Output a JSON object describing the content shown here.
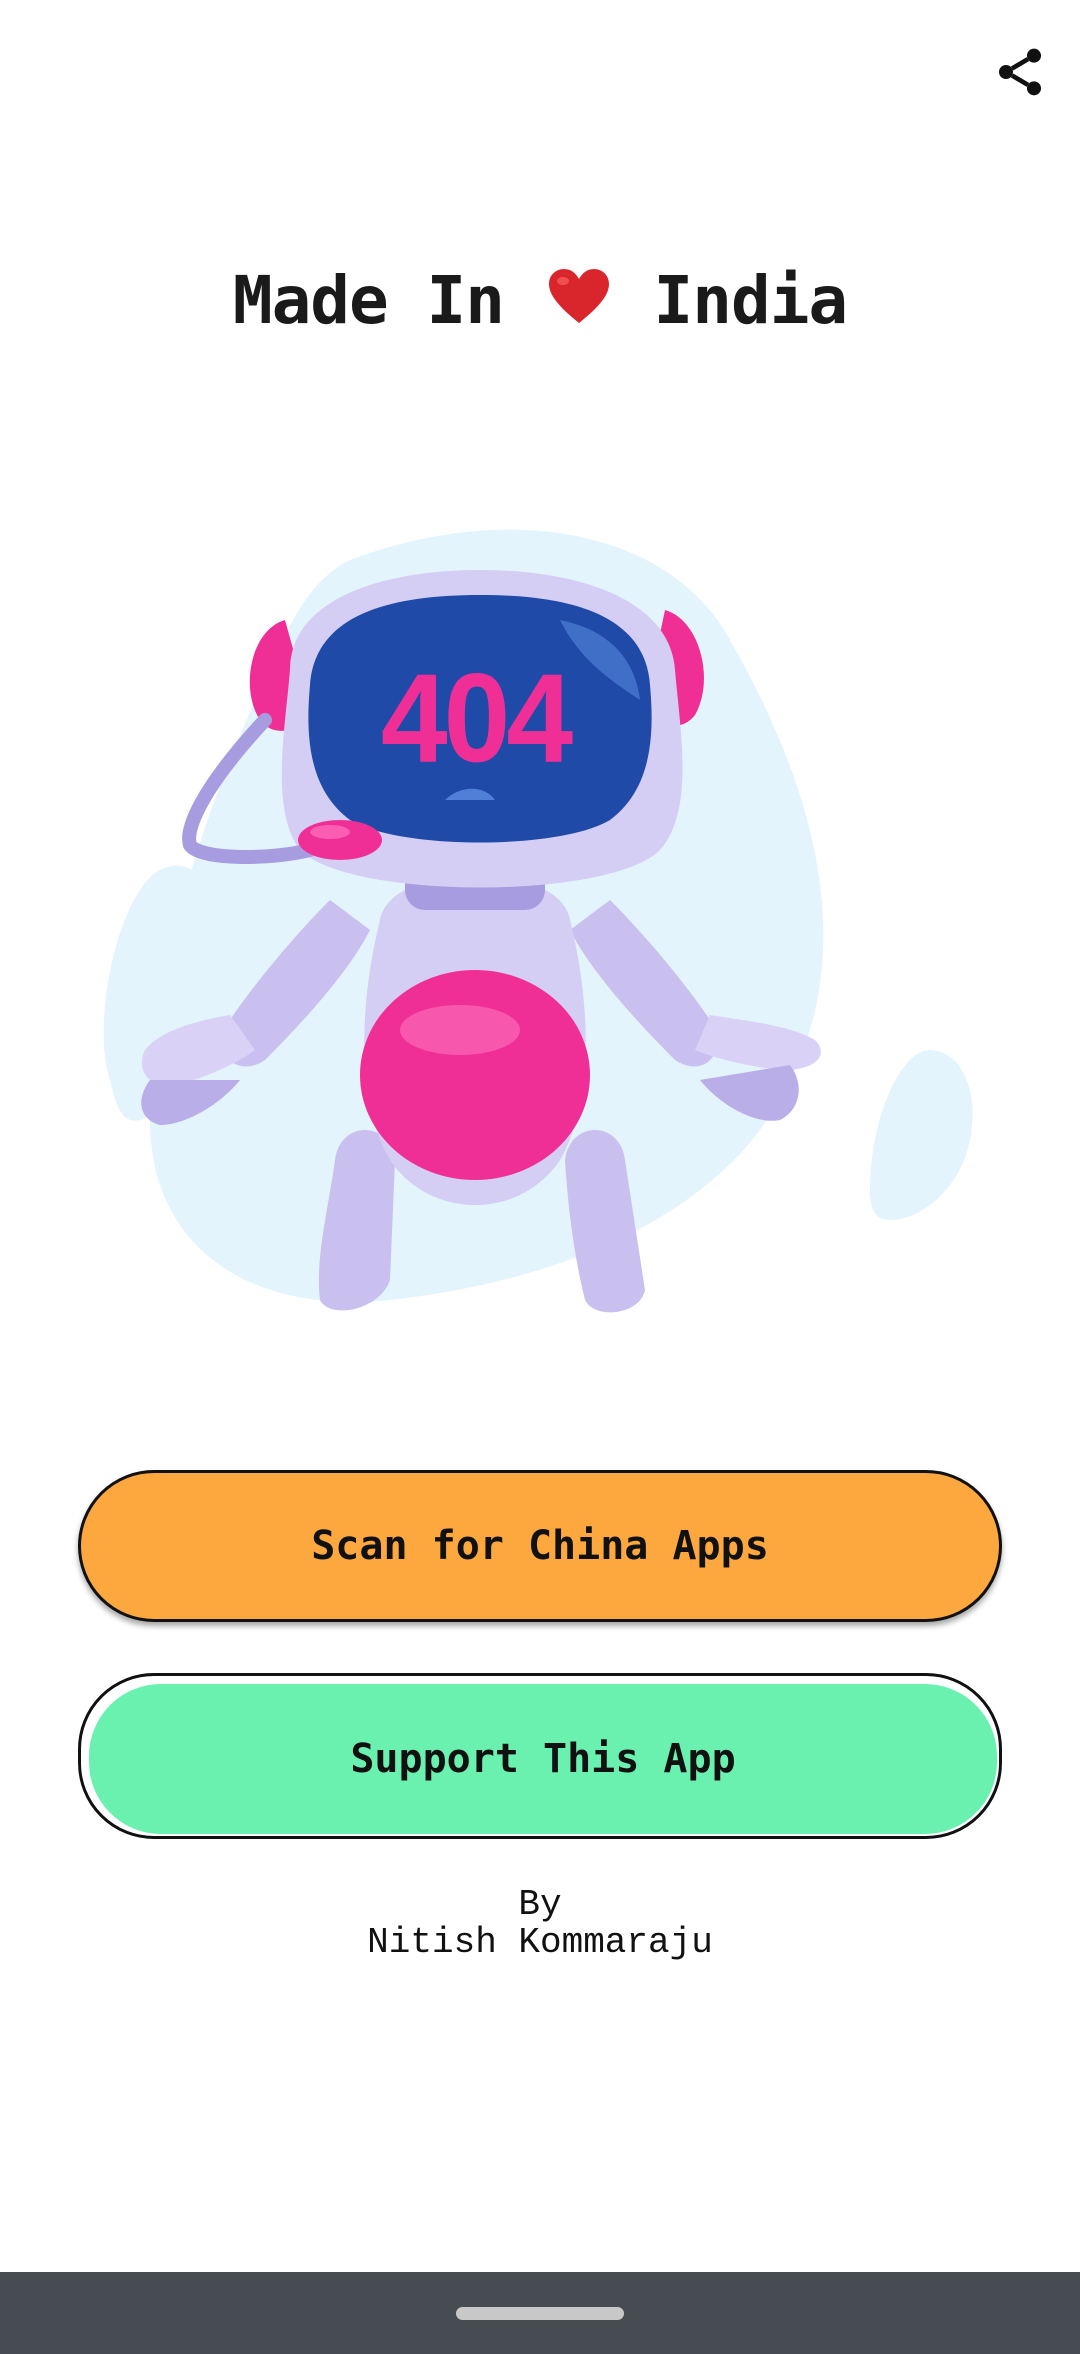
{
  "header": {
    "share_icon": "share-icon"
  },
  "title": {
    "prefix": "Made In",
    "heart_icon": "red-heart-icon",
    "suffix": "India",
    "heart_color": "#d9262c"
  },
  "illustration": {
    "name": "robot-404-illustration",
    "screen_text": "404",
    "colors": {
      "blob": "#e3f4fc",
      "body": "#c9c0f0",
      "screen": "#1f4aa8",
      "accent": "#ef2f96"
    }
  },
  "buttons": {
    "scan_label": "Scan for China Apps",
    "scan_color": "#fda83f",
    "support_label": "Support This App",
    "support_color": "#6af0af"
  },
  "credit": {
    "by": "By",
    "author": "Nitish Kommaraju"
  },
  "system": {
    "navbar_color": "#464c51"
  }
}
